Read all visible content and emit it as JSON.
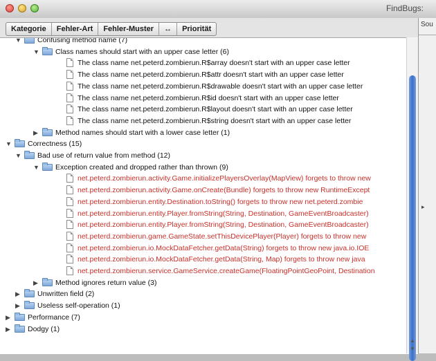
{
  "window": {
    "title": "FindBugs:",
    "toolbar": {
      "sort_segments": [
        "Kategorie",
        "Fehler-Art",
        "Fehler-Muster",
        "↔",
        "Priorität"
      ]
    },
    "side_panel": {
      "label": "Sou"
    }
  },
  "tree": {
    "rows": [
      {
        "label": "Confusing method name (7)",
        "icon": "folder-icon",
        "expand": "expanded",
        "level": 2,
        "color": "normal"
      },
      {
        "label": "Class names should start with an upper case letter (6)",
        "icon": "folder-icon",
        "expand": "expanded",
        "level": 3,
        "color": "normal"
      },
      {
        "label": "The class name net.peterd.zombierun.R$array doesn't start with an upper case letter",
        "icon": "file-icon",
        "expand": "none",
        "level": 4,
        "color": "normal"
      },
      {
        "label": "The class name net.peterd.zombierun.R$attr doesn't start with an upper case letter",
        "icon": "file-icon",
        "expand": "none",
        "level": 4,
        "color": "normal"
      },
      {
        "label": "The class name net.peterd.zombierun.R$drawable doesn't start with an upper case letter",
        "icon": "file-icon",
        "expand": "none",
        "level": 4,
        "color": "normal"
      },
      {
        "label": "The class name net.peterd.zombierun.R$id doesn't start with an upper case letter",
        "icon": "file-icon",
        "expand": "none",
        "level": 4,
        "color": "normal"
      },
      {
        "label": "The class name net.peterd.zombierun.R$layout doesn't start with an upper case letter",
        "icon": "file-icon",
        "expand": "none",
        "level": 4,
        "color": "normal"
      },
      {
        "label": "The class name net.peterd.zombierun.R$string doesn't start with an upper case letter",
        "icon": "file-icon",
        "expand": "none",
        "level": 4,
        "color": "normal"
      },
      {
        "label": "Method names should start with a lower case letter (1)",
        "icon": "folder-icon",
        "expand": "collapsed",
        "level": 3,
        "color": "normal"
      },
      {
        "label": "Correctness (15)",
        "icon": "folder-icon",
        "expand": "expanded",
        "level": 1,
        "color": "normal"
      },
      {
        "label": "Bad use of return value from method (12)",
        "icon": "folder-icon",
        "expand": "expanded",
        "level": 2,
        "color": "normal"
      },
      {
        "label": "Exception created and dropped rather than thrown (9)",
        "icon": "folder-icon",
        "expand": "expanded",
        "level": 3,
        "color": "normal"
      },
      {
        "label": "net.peterd.zombierun.activity.Game.initializePlayersOverlay(MapView) forgets to throw new",
        "icon": "file-icon",
        "expand": "none",
        "level": 4,
        "color": "red"
      },
      {
        "label": "net.peterd.zombierun.activity.Game.onCreate(Bundle) forgets to throw new RuntimeExcept",
        "icon": "file-icon",
        "expand": "none",
        "level": 4,
        "color": "red"
      },
      {
        "label": "net.peterd.zombierun.entity.Destination.toString() forgets to throw new net.peterd.zombie",
        "icon": "file-icon",
        "expand": "none",
        "level": 4,
        "color": "red"
      },
      {
        "label": "net.peterd.zombierun.entity.Player.fromString(String, Destination, GameEventBroadcaster)",
        "icon": "file-icon",
        "expand": "none",
        "level": 4,
        "color": "red"
      },
      {
        "label": "net.peterd.zombierun.entity.Player.fromString(String, Destination, GameEventBroadcaster)",
        "icon": "file-icon",
        "expand": "none",
        "level": 4,
        "color": "red"
      },
      {
        "label": "net.peterd.zombierun.game.GameState.setThisDevicePlayer(Player) forgets to throw new",
        "icon": "file-icon",
        "expand": "none",
        "level": 4,
        "color": "red"
      },
      {
        "label": "net.peterd.zombierun.io.MockDataFetcher.getData(String) forgets to throw new java.io.IOE",
        "icon": "file-icon",
        "expand": "none",
        "level": 4,
        "color": "red"
      },
      {
        "label": "net.peterd.zombierun.io.MockDataFetcher.getData(String, Map) forgets to throw new java",
        "icon": "file-icon",
        "expand": "none",
        "level": 4,
        "color": "red"
      },
      {
        "label": "net.peterd.zombierun.service.GameService.createGame(FloatingPointGeoPoint, Destination",
        "icon": "file-icon",
        "expand": "none",
        "level": 4,
        "color": "red"
      },
      {
        "label": "Method ignores return value (3)",
        "icon": "folder-icon",
        "expand": "collapsed",
        "level": 3,
        "color": "normal"
      },
      {
        "label": "Unwritten field (2)",
        "icon": "folder-icon",
        "expand": "collapsed",
        "level": 2,
        "color": "normal"
      },
      {
        "label": "Useless self-operation (1)",
        "icon": "folder-icon",
        "expand": "collapsed",
        "level": 2,
        "color": "normal"
      },
      {
        "label": "Performance (7)",
        "icon": "folder-icon",
        "expand": "collapsed",
        "level": 1,
        "color": "normal"
      },
      {
        "label": "Dodgy (1)",
        "icon": "folder-icon",
        "expand": "collapsed",
        "level": 1,
        "color": "normal"
      }
    ]
  },
  "colors": {
    "bug_text": "#c8302a",
    "normal_text": "#111111",
    "scroll_thumb": "#3d6fc8",
    "folder": "#7ea8d9"
  }
}
